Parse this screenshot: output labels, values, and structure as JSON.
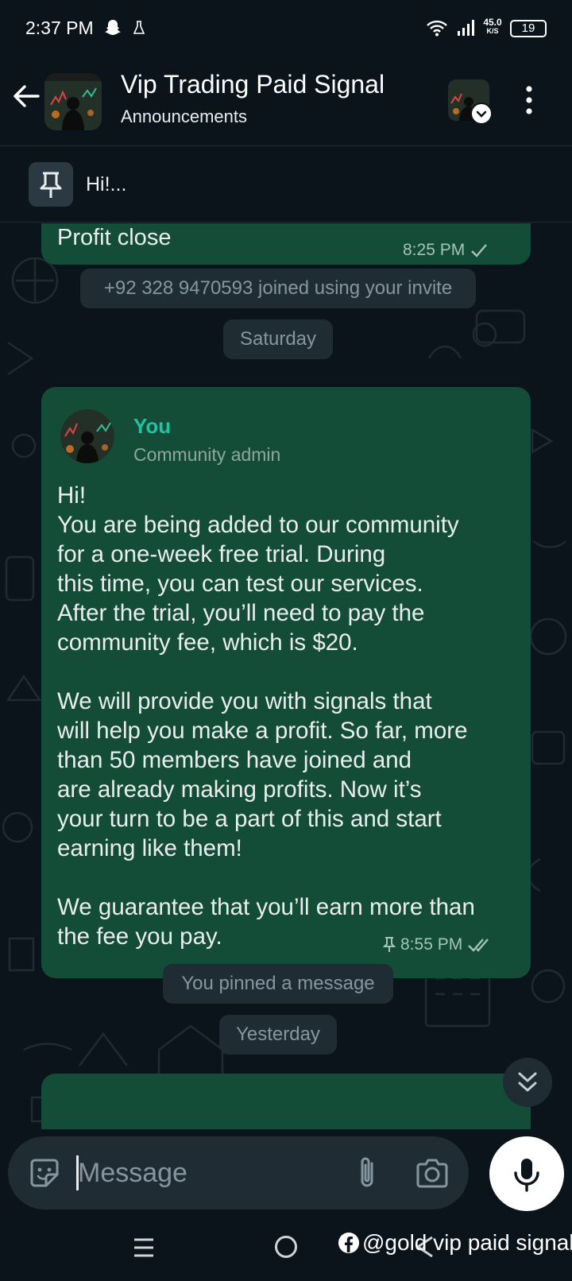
{
  "status_bar": {
    "time": "2:37 PM",
    "speed_value": "45.0",
    "speed_unit": "K/S",
    "battery": "19"
  },
  "header": {
    "title": "Vip Trading Paid Signal",
    "subtitle": "Announcements"
  },
  "pinned": {
    "text": "Hi!..."
  },
  "messages": {
    "profit": {
      "text": "Profit close",
      "time": "8:25 PM"
    },
    "joined": "+92 328 9470593 joined using your invite",
    "day_saturday": "Saturday",
    "main": {
      "sender": "You",
      "role": "Community admin",
      "body": "Hi!\nYou are being added to our community\nfor a one-week free trial. During\nthis time, you can test our services.\nAfter the trial, you’ll need to pay the\ncommunity fee, which is $20.\n\nWe will provide you with signals that\nwill help you make a profit. So far, more\nthan 50 members have joined and\nare already making profits. Now it’s\nyour turn to be a part of this and start\nearning like them!\n\nWe guarantee that you’ll earn more than\nthe fee you pay.",
      "time": "8:55 PM"
    },
    "pinned_notice": "You pinned a message",
    "day_yesterday": "Yesterday"
  },
  "composer": {
    "placeholder": "Message"
  },
  "watermark": "@gold vip paid signal",
  "colors": {
    "background": "#0b141a",
    "bubble": "#144d37",
    "sender_accent": "#21c2a5",
    "system_pill": "#1f2c34"
  }
}
